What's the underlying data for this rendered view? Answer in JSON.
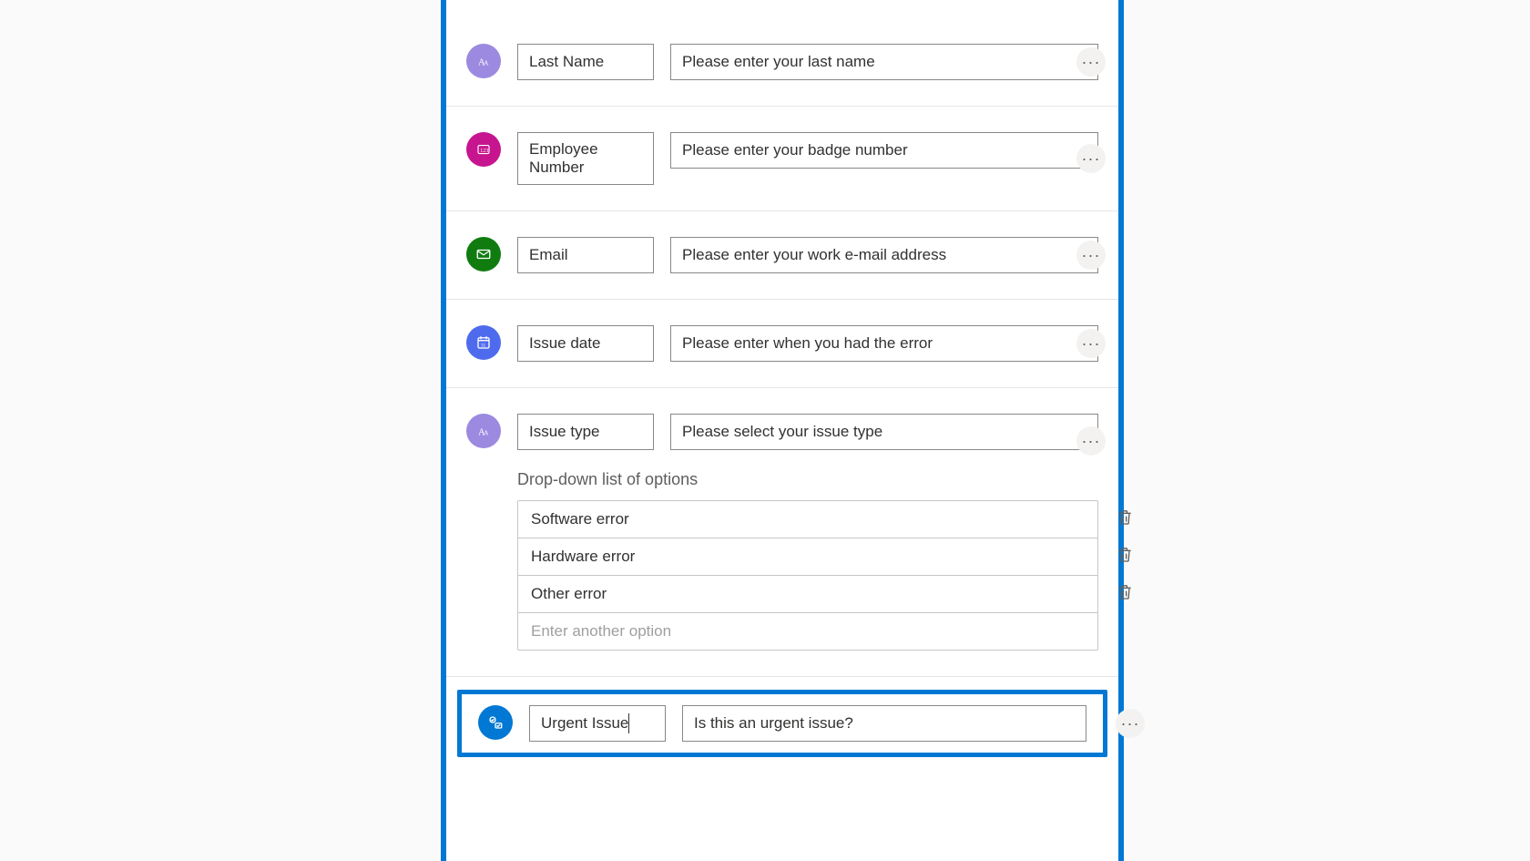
{
  "fields": [
    {
      "icon": "text",
      "iconColor": "purp",
      "label": "Last Name",
      "prompt": "Please enter your last name"
    },
    {
      "icon": "number",
      "iconColor": "pink",
      "label": "Employee Number",
      "prompt": "Please enter your badge number"
    },
    {
      "icon": "email",
      "iconColor": "green",
      "label": "Email",
      "prompt": "Please enter your work e-mail address"
    },
    {
      "icon": "date",
      "iconColor": "blue",
      "label": "Issue date",
      "prompt": "Please enter when you had the error"
    },
    {
      "icon": "text",
      "iconColor": "purp",
      "label": "Issue type",
      "prompt": "Please select your issue type",
      "dropdown": {
        "title": "Drop-down list of options",
        "options": [
          "Software error",
          "Hardware error",
          "Other error"
        ],
        "newPlaceholder": "Enter another option"
      }
    },
    {
      "icon": "multichoice",
      "iconColor": "dblue",
      "label": "Urgent Issue",
      "prompt": "Is this an urgent issue?",
      "selected": true
    }
  ],
  "ui": {
    "moreGlyph": "···"
  }
}
